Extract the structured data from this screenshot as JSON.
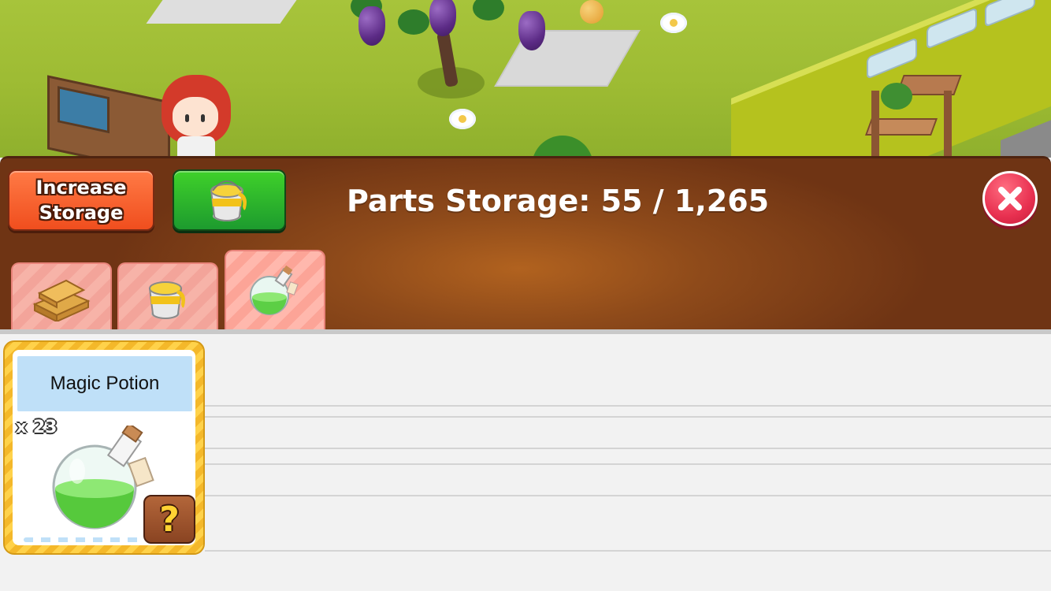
{
  "header": {
    "increase_storage_label": "Increase\nStorage",
    "title_prefix": "Parts Storage:",
    "storage_used": "55",
    "storage_capacity": "1,265",
    "paint_button_icon": "paint-bucket-icon",
    "close_icon": "close-icon"
  },
  "tabs": [
    {
      "icon": "wood-planks-icon",
      "active": false
    },
    {
      "icon": "paint-bucket-icon",
      "active": false
    },
    {
      "icon": "potion-icon",
      "active": true
    }
  ],
  "items": [
    {
      "name": "Magic Potion",
      "quantity": "x 23",
      "icon": "potion-icon",
      "info_label": "?"
    }
  ],
  "colors": {
    "panel_brown": "#8e4a1a",
    "increase_orange": "#f04e1e",
    "paint_green": "#1d9b2e",
    "close_red": "#e83050",
    "tab_pink": "#f7b3a8",
    "card_gold": "#f4b82a",
    "name_bar_blue": "#bfe0f8"
  }
}
